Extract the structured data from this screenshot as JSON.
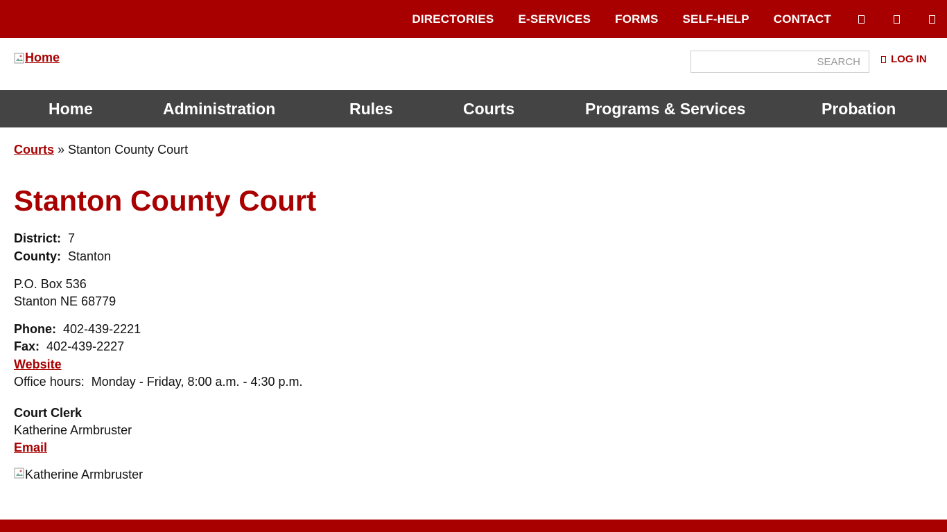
{
  "top_nav": {
    "links": [
      "DIRECTORIES",
      "E-SERVICES",
      "FORMS",
      "SELF-HELP",
      "CONTACT"
    ],
    "icons": [
      "facebook-icon",
      "twitter-icon",
      "youtube-icon"
    ]
  },
  "header": {
    "logo_alt": "Home",
    "search_placeholder": "SEARCH",
    "login_label": "LOG IN"
  },
  "main_nav": [
    "Home",
    "Administration",
    "Rules",
    "Courts",
    "Programs & Services",
    "Probation"
  ],
  "breadcrumb": {
    "parent": "Courts",
    "separator": "»",
    "current": "Stanton County Court"
  },
  "page": {
    "title": "Stanton County Court",
    "district_label": "District:",
    "district": "7",
    "county_label": "County:",
    "county": "Stanton",
    "address1": "P.O. Box 536",
    "address2": "Stanton NE 68779",
    "phone_label": "Phone:",
    "phone": "402-439-2221",
    "fax_label": "Fax:",
    "fax": "402-439-2227",
    "website_label": "Website",
    "office_hours_label": "Office hours:",
    "office_hours": "Monday - Friday, 8:00 a.m. - 4:30 p.m.",
    "clerk_title": "Court Clerk",
    "clerk_name": "Katherine Armbruster",
    "email_label": "Email",
    "clerk_image_alt": "Katherine Armbruster"
  },
  "colors": {
    "brand": "#a80000",
    "nav_bg": "#444444"
  }
}
